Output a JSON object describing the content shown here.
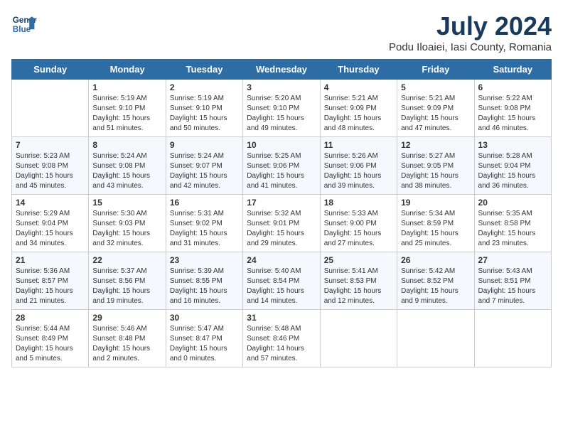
{
  "header": {
    "logo_line1": "General",
    "logo_line2": "Blue",
    "month_title": "July 2024",
    "location": "Podu Iloaiei, Iasi County, Romania"
  },
  "days_of_week": [
    "Sunday",
    "Monday",
    "Tuesday",
    "Wednesday",
    "Thursday",
    "Friday",
    "Saturday"
  ],
  "weeks": [
    [
      {
        "day": "",
        "info": ""
      },
      {
        "day": "1",
        "info": "Sunrise: 5:19 AM\nSunset: 9:10 PM\nDaylight: 15 hours\nand 51 minutes."
      },
      {
        "day": "2",
        "info": "Sunrise: 5:19 AM\nSunset: 9:10 PM\nDaylight: 15 hours\nand 50 minutes."
      },
      {
        "day": "3",
        "info": "Sunrise: 5:20 AM\nSunset: 9:10 PM\nDaylight: 15 hours\nand 49 minutes."
      },
      {
        "day": "4",
        "info": "Sunrise: 5:21 AM\nSunset: 9:09 PM\nDaylight: 15 hours\nand 48 minutes."
      },
      {
        "day": "5",
        "info": "Sunrise: 5:21 AM\nSunset: 9:09 PM\nDaylight: 15 hours\nand 47 minutes."
      },
      {
        "day": "6",
        "info": "Sunrise: 5:22 AM\nSunset: 9:08 PM\nDaylight: 15 hours\nand 46 minutes."
      }
    ],
    [
      {
        "day": "7",
        "info": "Sunrise: 5:23 AM\nSunset: 9:08 PM\nDaylight: 15 hours\nand 45 minutes."
      },
      {
        "day": "8",
        "info": "Sunrise: 5:24 AM\nSunset: 9:08 PM\nDaylight: 15 hours\nand 43 minutes."
      },
      {
        "day": "9",
        "info": "Sunrise: 5:24 AM\nSunset: 9:07 PM\nDaylight: 15 hours\nand 42 minutes."
      },
      {
        "day": "10",
        "info": "Sunrise: 5:25 AM\nSunset: 9:06 PM\nDaylight: 15 hours\nand 41 minutes."
      },
      {
        "day": "11",
        "info": "Sunrise: 5:26 AM\nSunset: 9:06 PM\nDaylight: 15 hours\nand 39 minutes."
      },
      {
        "day": "12",
        "info": "Sunrise: 5:27 AM\nSunset: 9:05 PM\nDaylight: 15 hours\nand 38 minutes."
      },
      {
        "day": "13",
        "info": "Sunrise: 5:28 AM\nSunset: 9:04 PM\nDaylight: 15 hours\nand 36 minutes."
      }
    ],
    [
      {
        "day": "14",
        "info": "Sunrise: 5:29 AM\nSunset: 9:04 PM\nDaylight: 15 hours\nand 34 minutes."
      },
      {
        "day": "15",
        "info": "Sunrise: 5:30 AM\nSunset: 9:03 PM\nDaylight: 15 hours\nand 32 minutes."
      },
      {
        "day": "16",
        "info": "Sunrise: 5:31 AM\nSunset: 9:02 PM\nDaylight: 15 hours\nand 31 minutes."
      },
      {
        "day": "17",
        "info": "Sunrise: 5:32 AM\nSunset: 9:01 PM\nDaylight: 15 hours\nand 29 minutes."
      },
      {
        "day": "18",
        "info": "Sunrise: 5:33 AM\nSunset: 9:00 PM\nDaylight: 15 hours\nand 27 minutes."
      },
      {
        "day": "19",
        "info": "Sunrise: 5:34 AM\nSunset: 8:59 PM\nDaylight: 15 hours\nand 25 minutes."
      },
      {
        "day": "20",
        "info": "Sunrise: 5:35 AM\nSunset: 8:58 PM\nDaylight: 15 hours\nand 23 minutes."
      }
    ],
    [
      {
        "day": "21",
        "info": "Sunrise: 5:36 AM\nSunset: 8:57 PM\nDaylight: 15 hours\nand 21 minutes."
      },
      {
        "day": "22",
        "info": "Sunrise: 5:37 AM\nSunset: 8:56 PM\nDaylight: 15 hours\nand 19 minutes."
      },
      {
        "day": "23",
        "info": "Sunrise: 5:39 AM\nSunset: 8:55 PM\nDaylight: 15 hours\nand 16 minutes."
      },
      {
        "day": "24",
        "info": "Sunrise: 5:40 AM\nSunset: 8:54 PM\nDaylight: 15 hours\nand 14 minutes."
      },
      {
        "day": "25",
        "info": "Sunrise: 5:41 AM\nSunset: 8:53 PM\nDaylight: 15 hours\nand 12 minutes."
      },
      {
        "day": "26",
        "info": "Sunrise: 5:42 AM\nSunset: 8:52 PM\nDaylight: 15 hours\nand 9 minutes."
      },
      {
        "day": "27",
        "info": "Sunrise: 5:43 AM\nSunset: 8:51 PM\nDaylight: 15 hours\nand 7 minutes."
      }
    ],
    [
      {
        "day": "28",
        "info": "Sunrise: 5:44 AM\nSunset: 8:49 PM\nDaylight: 15 hours\nand 5 minutes."
      },
      {
        "day": "29",
        "info": "Sunrise: 5:46 AM\nSunset: 8:48 PM\nDaylight: 15 hours\nand 2 minutes."
      },
      {
        "day": "30",
        "info": "Sunrise: 5:47 AM\nSunset: 8:47 PM\nDaylight: 15 hours\nand 0 minutes."
      },
      {
        "day": "31",
        "info": "Sunrise: 5:48 AM\nSunset: 8:46 PM\nDaylight: 14 hours\nand 57 minutes."
      },
      {
        "day": "",
        "info": ""
      },
      {
        "day": "",
        "info": ""
      },
      {
        "day": "",
        "info": ""
      }
    ]
  ]
}
